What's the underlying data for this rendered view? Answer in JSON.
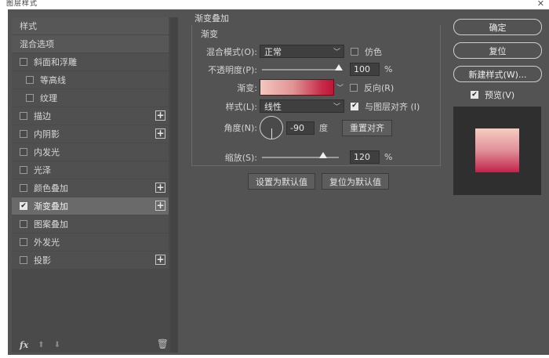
{
  "window": {
    "title": "图层样式"
  },
  "left_panel": {
    "items": [
      {
        "label": "样式",
        "checkbox": false,
        "checked": false,
        "plus": false,
        "type": "header"
      },
      {
        "label": "混合选项",
        "checkbox": false,
        "checked": false,
        "plus": false,
        "type": "header"
      },
      {
        "label": "斜面和浮雕",
        "checkbox": true,
        "checked": false,
        "plus": false,
        "type": "normal"
      },
      {
        "label": "等高线",
        "checkbox": true,
        "checked": false,
        "plus": false,
        "type": "indent"
      },
      {
        "label": "纹理",
        "checkbox": true,
        "checked": false,
        "plus": false,
        "type": "indent"
      },
      {
        "label": "描边",
        "checkbox": true,
        "checked": false,
        "plus": true,
        "type": "normal"
      },
      {
        "label": "内阴影",
        "checkbox": true,
        "checked": false,
        "plus": true,
        "type": "normal"
      },
      {
        "label": "内发光",
        "checkbox": true,
        "checked": false,
        "plus": false,
        "type": "normal"
      },
      {
        "label": "光泽",
        "checkbox": true,
        "checked": false,
        "plus": false,
        "type": "normal"
      },
      {
        "label": "颜色叠加",
        "checkbox": true,
        "checked": false,
        "plus": true,
        "type": "normal"
      },
      {
        "label": "渐变叠加",
        "checkbox": true,
        "checked": true,
        "plus": true,
        "type": "selected"
      },
      {
        "label": "图案叠加",
        "checkbox": true,
        "checked": false,
        "plus": false,
        "type": "normal"
      },
      {
        "label": "外发光",
        "checkbox": true,
        "checked": false,
        "plus": false,
        "type": "normal"
      },
      {
        "label": "投影",
        "checkbox": true,
        "checked": false,
        "plus": true,
        "type": "normal"
      }
    ],
    "footer": {
      "fx": "fx",
      "up": "⬆",
      "down": "⬇",
      "trash": "🗑"
    }
  },
  "gradient_overlay": {
    "section_title": "渐变叠加",
    "group_title": "渐变",
    "blend_mode_label": "混合模式(O):",
    "blend_mode_value": "正常",
    "dither_label": "仿色",
    "opacity_label": "不透明度(P):",
    "opacity_value": "100",
    "opacity_unit": "%",
    "opacity_level": 1.0,
    "gradient_label": "渐变:",
    "reverse_label": "反向(R)",
    "style_label": "样式(L):",
    "style_value": "线性",
    "align_label": "与图层对齐 (I)",
    "angle_label": "角度(N):",
    "angle_value": "-90",
    "angle_unit": "度",
    "reset_align_label": "重置对齐",
    "scale_label": "缩放(S):",
    "scale_value": "120",
    "scale_unit": "%",
    "scale_level": 0.8,
    "set_default_label": "设置为默认值",
    "reset_default_label": "复位为默认值"
  },
  "right_panel": {
    "ok_label": "确定",
    "reset_label": "复位",
    "new_style_label": "新建样式(W)...",
    "preview_label": "预览(V)"
  },
  "colors": {
    "gradient_start": "#f4c6bf",
    "gradient_end": "#b9183a"
  }
}
